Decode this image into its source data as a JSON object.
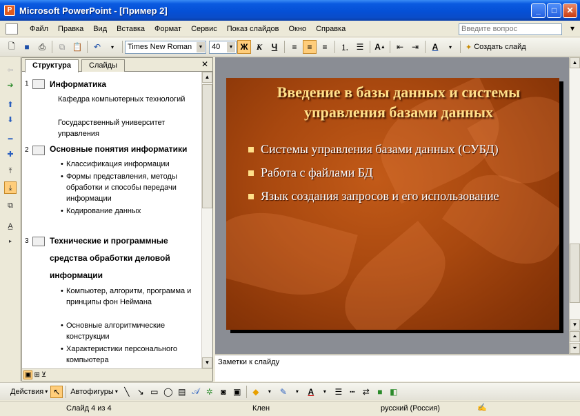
{
  "window": {
    "title": "Microsoft PowerPoint - [Пример 2]",
    "app_icon": "P"
  },
  "menu": {
    "items": [
      "Файл",
      "Правка",
      "Вид",
      "Вставка",
      "Формат",
      "Сервис",
      "Показ слайдов",
      "Окно",
      "Справка"
    ],
    "help_placeholder": "Введите вопрос"
  },
  "toolbar": {
    "font": "Times New Roman",
    "size": "40",
    "bold": "Ж",
    "italic": "К",
    "underline": "Ч",
    "create_slide": "Создать слайд"
  },
  "outline": {
    "tabs": [
      "Структура",
      "Слайды"
    ],
    "slides": [
      {
        "num": "1",
        "title": "Информатика",
        "subs": [
          "Кафедра компьютерных технологий",
          "Государственный университет управления"
        ],
        "bullets": []
      },
      {
        "num": "2",
        "title": "Основные понятия информатики",
        "subs": [],
        "bullets": [
          "Классификация информации",
          "Формы представления, методы обработки и способы передачи информации",
          "Кодирование данных"
        ]
      },
      {
        "num": "3",
        "title": "Технические и программные средства обработки деловой информации",
        "subs": [],
        "bullets": [
          "Компьютер, алгоритм, программа и принципы фон Неймана",
          "Основные алгоритмические конструкции",
          "Характеристики персонального компьютера"
        ]
      }
    ]
  },
  "slide": {
    "title": "Введение в базы данных и системы управления базами данных",
    "bullets": [
      "Системы управления базами данных (СУБД)",
      "Работа с файлами БД",
      "Язык создания запросов и его использование"
    ],
    "bg_color": "#a8480f",
    "title_color": "#ffe08a"
  },
  "notes": {
    "placeholder": "Заметки к слайду"
  },
  "draw_toolbar": {
    "actions": "Действия",
    "autoshapes": "Автофигуры"
  },
  "status": {
    "slide_pos": "Слайд 4 из 4",
    "design": "Клен",
    "language": "русский (Россия)"
  }
}
